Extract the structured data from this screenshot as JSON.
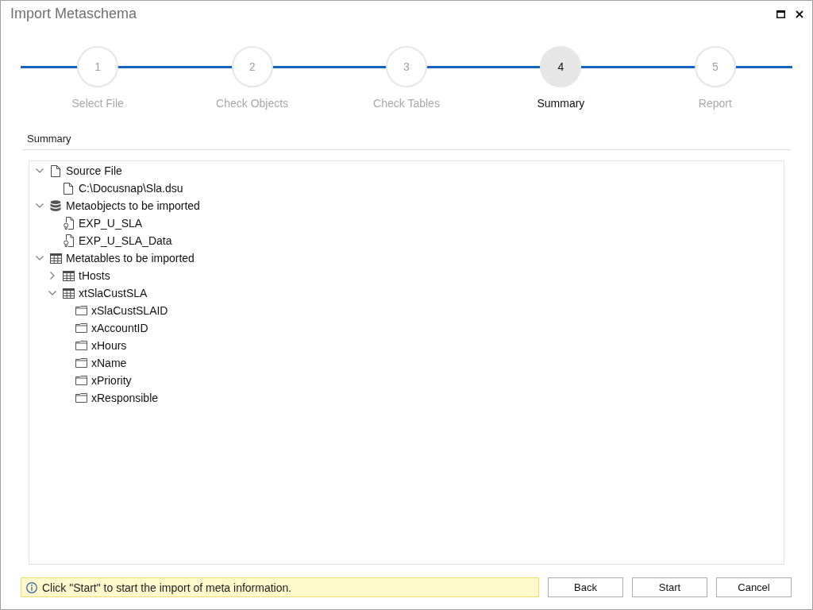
{
  "window": {
    "title": "Import Metaschema"
  },
  "steps": [
    {
      "number": "1",
      "label": "Select File",
      "selected": false
    },
    {
      "number": "2",
      "label": "Check Objects",
      "selected": false
    },
    {
      "number": "3",
      "label": "Check Tables",
      "selected": false
    },
    {
      "number": "4",
      "label": "Summary",
      "selected": true
    },
    {
      "number": "5",
      "label": "Report",
      "selected": false
    }
  ],
  "section": {
    "title": "Summary"
  },
  "tree": [
    {
      "label": "Source File",
      "kind": "file",
      "expanded": true,
      "children": [
        {
          "label": "C:\\Docusnap\\Sla.dsu",
          "kind": "file"
        }
      ]
    },
    {
      "label": "Metaobjects to be imported",
      "kind": "database",
      "expanded": true,
      "children": [
        {
          "label": "EXP_U_SLA",
          "kind": "metaobject"
        },
        {
          "label": "EXP_U_SLA_Data",
          "kind": "metaobject"
        }
      ]
    },
    {
      "label": "Metatables to be imported",
      "kind": "table",
      "expanded": true,
      "children": [
        {
          "label": "tHosts",
          "kind": "table",
          "expanded": false
        },
        {
          "label": "xtSlaCustSLA",
          "kind": "table",
          "expanded": true,
          "children": [
            {
              "label": "xSlaCustSLAID",
              "kind": "folder"
            },
            {
              "label": "xAccountID",
              "kind": "folder"
            },
            {
              "label": "xHours",
              "kind": "folder"
            },
            {
              "label": "xName",
              "kind": "folder"
            },
            {
              "label": "xPriority",
              "kind": "folder"
            },
            {
              "label": "xResponsible",
              "kind": "folder"
            }
          ]
        }
      ]
    }
  ],
  "info": {
    "message": "Click \"Start\" to start the import of meta information."
  },
  "buttons": [
    {
      "label": "Back"
    },
    {
      "label": "Start"
    },
    {
      "label": "Cancel"
    }
  ]
}
